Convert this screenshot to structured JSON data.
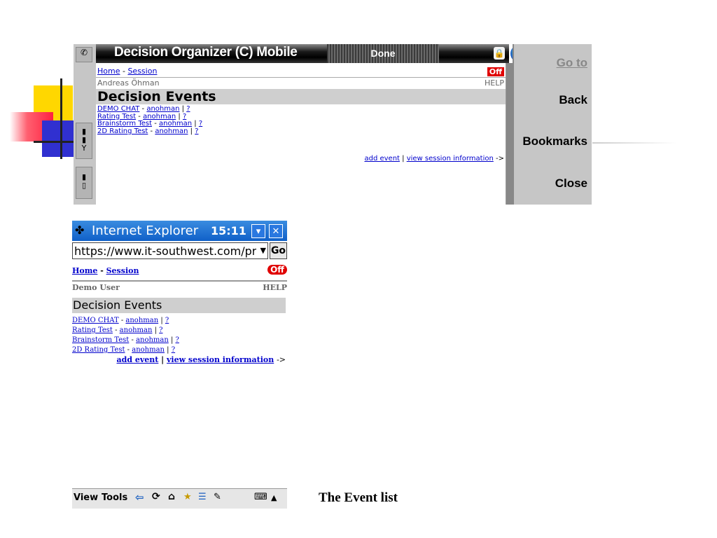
{
  "communicator": {
    "title": "Decision Organizer (C) Mobile",
    "status": "Done",
    "nav": {
      "home": "Home",
      "separator": " - ",
      "session": "Session"
    },
    "off_label": "Off",
    "user_name": "Andreas Öhman",
    "help_label": "HELP",
    "heading": "Decision Events",
    "events": [
      {
        "name": "DEMO CHAT",
        "owner": "anohman",
        "help": "?"
      },
      {
        "name": "Rating Test",
        "owner": "anohman",
        "help": "?"
      },
      {
        "name": "Brainstorm Test",
        "owner": "anohman",
        "help": "?"
      },
      {
        "name": "2D Rating Test",
        "owner": "anohman",
        "help": "?"
      }
    ],
    "add_event": "add event",
    "view_session_info": "view session information",
    "arrow": "->",
    "side_buttons": {
      "goto": "Go to",
      "back": "Back",
      "bookmarks": "Bookmarks",
      "close": "Close"
    }
  },
  "pocketpc": {
    "title": "Internet Explorer",
    "time": "15:11",
    "address": "https://www.it-southwest.com/priv",
    "go_label": "Go",
    "nav": {
      "home": "Home",
      "separator": " - ",
      "session": "Session"
    },
    "off_label": "Off",
    "user_name": "Demo User",
    "help_label": "HELP",
    "heading": "Decision Events",
    "events": [
      {
        "name": "DEMO CHAT",
        "owner": "anohman",
        "help": "?"
      },
      {
        "name": "Rating Test",
        "owner": "anohman",
        "help": "?"
      },
      {
        "name": "Brainstorm Test",
        "owner": "anohman",
        "help": "?"
      },
      {
        "name": "2D Rating Test",
        "owner": "anohman",
        "help": "?"
      }
    ],
    "add_event": "add event",
    "view_session_info": "view session information",
    "arrow": "->",
    "toolbar": {
      "view": "View",
      "tools": "Tools"
    }
  },
  "caption": "The Event list"
}
